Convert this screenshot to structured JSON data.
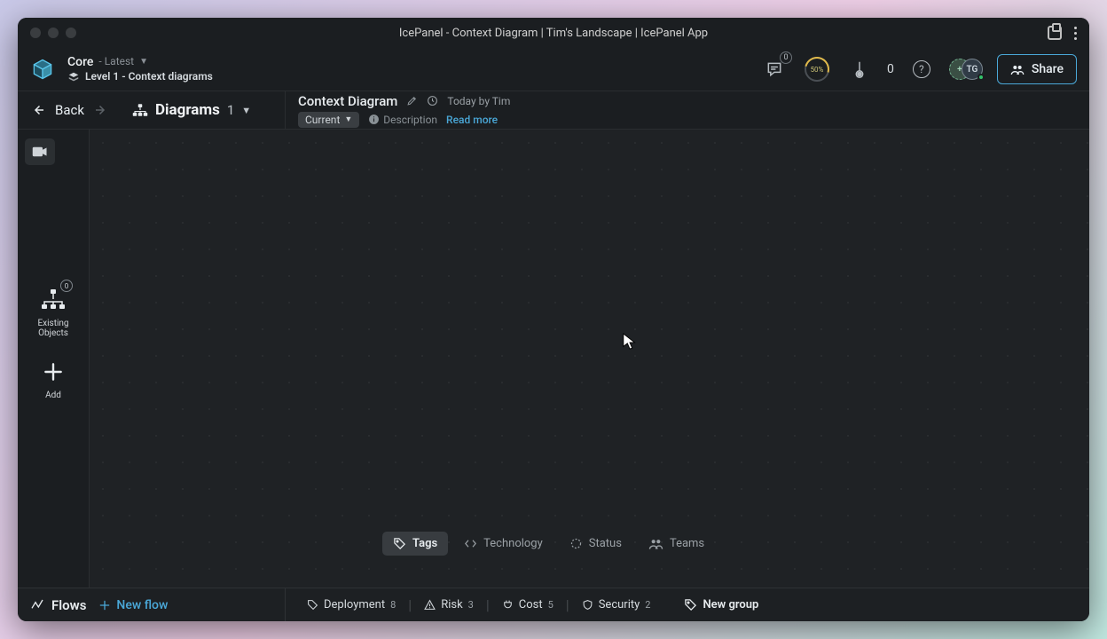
{
  "window": {
    "title": "IcePanel - Context Diagram | Tim's Landscape | IcePanel App"
  },
  "header": {
    "project": "Core",
    "version_label": "Latest",
    "level_label": "Level 1 - Context diagrams",
    "comments_badge": "0",
    "gauge_text": "50%",
    "therm_count": "0",
    "avatar1": "+",
    "avatar2": "TG",
    "share_label": "Share"
  },
  "subheader": {
    "back_label": "Back",
    "diagrams_label": "Diagrams",
    "diagrams_count": "1",
    "diagram_name": "Context Diagram",
    "updated_label": "Today by Tim",
    "state_label": "Current",
    "description_label": "Description",
    "readmore_label": "Read more"
  },
  "rail": {
    "existing_badge": "0",
    "existing_label": "Existing Objects",
    "add_label": "Add"
  },
  "tabs": [
    {
      "label": "Tags",
      "active": true
    },
    {
      "label": "Technology",
      "active": false
    },
    {
      "label": "Status",
      "active": false
    },
    {
      "label": "Teams",
      "active": false
    }
  ],
  "footer": {
    "flows_label": "Flows",
    "newflow_label": "New flow",
    "tags": [
      {
        "label": "Deployment",
        "count": "8"
      },
      {
        "label": "Risk",
        "count": "3"
      },
      {
        "label": "Cost",
        "count": "5"
      },
      {
        "label": "Security",
        "count": "2"
      }
    ],
    "newgroup_label": "New group"
  }
}
